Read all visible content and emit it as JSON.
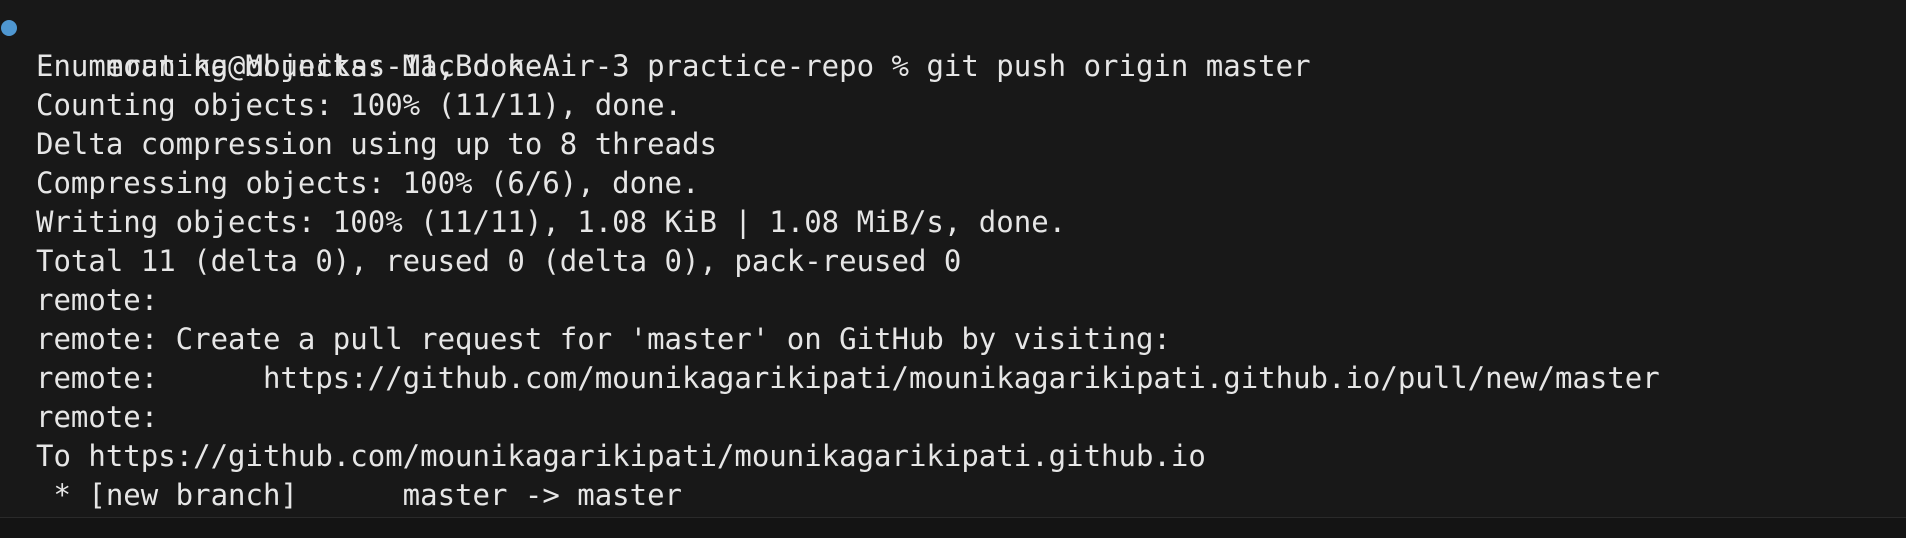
{
  "terminal": {
    "prompt": "mounika@Mounikas-MacBook-Air-3 practice-repo % git push origin master",
    "lines": [
      "Enumerating objects: 11, done.",
      "Counting objects: 100% (11/11), done.",
      "Delta compression using up to 8 threads",
      "Compressing objects: 100% (6/6), done.",
      "Writing objects: 100% (11/11), 1.08 KiB | 1.08 MiB/s, done.",
      "Total 11 (delta 0), reused 0 (delta 0), pack-reused 0",
      "remote:",
      "remote: Create a pull request for 'master' on GitHub by visiting:",
      "remote:      https://github.com/mounikagarikipati/mounikagarikipati.github.io/pull/new/master",
      "remote:",
      "To https://github.com/mounikagarikipati/mounikagarikipati.github.io",
      " * [new branch]      master -> master"
    ],
    "prompt_dot_color": "#4f97d1",
    "text_color": "#e6e6e6",
    "background": "#181818"
  }
}
